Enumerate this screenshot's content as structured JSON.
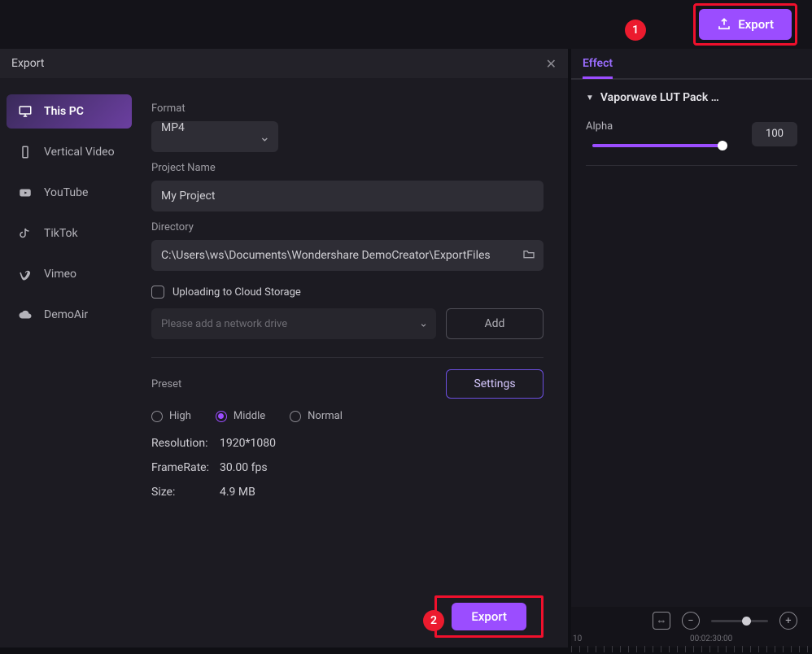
{
  "topbar": {
    "export_label": "Export"
  },
  "badges": {
    "one": "1",
    "two": "2"
  },
  "dialog": {
    "title": "Export",
    "sidebar": {
      "items": [
        {
          "label": "This PC"
        },
        {
          "label": "Vertical Video"
        },
        {
          "label": "YouTube"
        },
        {
          "label": "TikTok"
        },
        {
          "label": "Vimeo"
        },
        {
          "label": "DemoAir"
        }
      ]
    },
    "format": {
      "label": "Format",
      "value": "MP4"
    },
    "project": {
      "label": "Project Name",
      "value": "My Project"
    },
    "directory": {
      "label": "Directory",
      "value": "C:\\Users\\ws\\Documents\\Wondershare DemoCreator\\ExportFiles"
    },
    "cloud": {
      "check_label": "Uploading to Cloud Storage",
      "placeholder": "Please add a network drive",
      "add_label": "Add"
    },
    "preset": {
      "label": "Preset",
      "settings_label": "Settings",
      "options": {
        "high": "High",
        "middle": "Middle",
        "normal": "Normal"
      }
    },
    "info": {
      "resolution_label": "Resolution:",
      "resolution_value": "1920*1080",
      "framerate_label": "FrameRate:",
      "framerate_value": "30.00 fps",
      "size_label": "Size:",
      "size_value": "4.9 MB"
    },
    "footer": {
      "export_label": "Export"
    }
  },
  "panel": {
    "tab": "Effect",
    "section": "Vaporwave LUT Pack …",
    "alpha": {
      "label": "Alpha",
      "value": "100"
    }
  },
  "timeline": {
    "t0": "10",
    "t1": "00:02:30:00"
  }
}
